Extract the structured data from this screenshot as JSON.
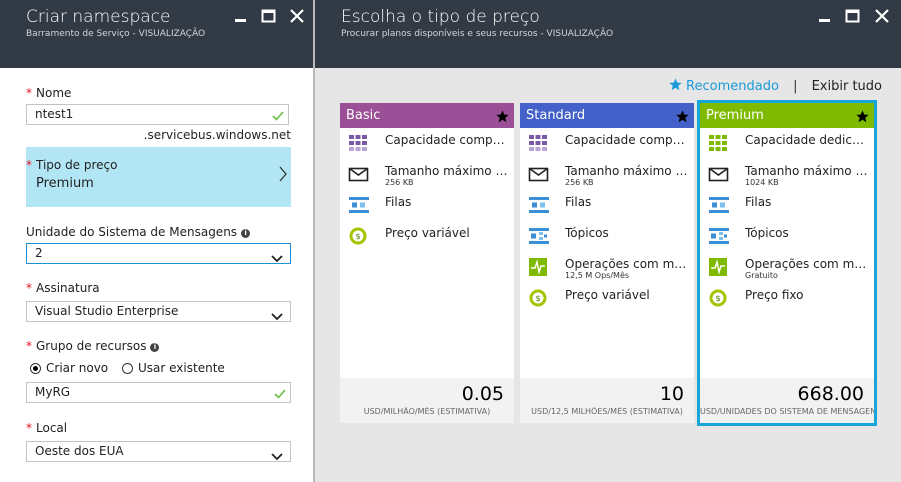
{
  "left": {
    "title": "Criar namespace",
    "subtitle": "Barramento de Serviço - VISUALIZAÇÃO",
    "name_label": "Nome",
    "name_value": "ntest1",
    "name_suffix": ".servicebus.windows.net",
    "pricing_label": "Tipo de preço",
    "pricing_value": "Premium",
    "units_label": "Unidade do Sistema de Mensagens",
    "units_value": "2",
    "subscription_label": "Assinatura",
    "subscription_value": "Visual Studio Enterprise",
    "rg_label": "Grupo de recursos",
    "rg_create_new": "Criar novo",
    "rg_use_existing": "Usar existente",
    "rg_value": "MyRG",
    "location_label": "Local",
    "location_value": "Oeste dos EUA",
    "required_mark": "*",
    "info_mark": "i"
  },
  "right": {
    "title": "Escolha o tipo de preço",
    "subtitle": "Procurar planos disponíveis e seus recursos - VISUALIZAÇÃO",
    "recommended": "Recomendado",
    "separator": "|",
    "view_all": "Exibir tudo",
    "cards": [
      {
        "name": "Basic",
        "color": "#9b4f96",
        "features": [
          {
            "icon": "capacity-icon",
            "title": "Capacidade compartilhada",
            "sub": ""
          },
          {
            "icon": "message-size-icon",
            "title": "Tamanho máximo da mensagem",
            "sub": "256 KB"
          },
          {
            "icon": "queues-icon",
            "title": "Filas",
            "sub": ""
          },
          {
            "icon": "price-icon",
            "title": "Preço variável",
            "sub": ""
          }
        ],
        "price": "0.05",
        "unit": "USD/MILHÃO/MÊS (ESTIMATIVA)"
      },
      {
        "name": "Standard",
        "color": "#4361c8",
        "features": [
          {
            "icon": "capacity-icon",
            "title": "Capacidade compartilhada",
            "sub": ""
          },
          {
            "icon": "message-size-icon",
            "title": "Tamanho máximo da mensagem",
            "sub": "256 KB"
          },
          {
            "icon": "queues-icon",
            "title": "Filas",
            "sub": ""
          },
          {
            "icon": "topics-icon",
            "title": "Tópicos",
            "sub": ""
          },
          {
            "icon": "operations-icon",
            "title": "Operações com mensagens",
            "sub": "12,5 M Ops/Mês"
          },
          {
            "icon": "price-icon",
            "title": "Preço variável",
            "sub": ""
          }
        ],
        "price": "10",
        "unit": "USD/12,5 MILHÕES/MÊS (ESTIMATIVA)"
      },
      {
        "name": "Premium",
        "color": "#7fba00",
        "features": [
          {
            "icon": "dedicated-capacity-icon",
            "title": "Capacidade dedicada",
            "sub": ""
          },
          {
            "icon": "message-size-icon",
            "title": "Tamanho máximo da mensagem",
            "sub": "1024 KB"
          },
          {
            "icon": "queues-icon",
            "title": "Filas",
            "sub": ""
          },
          {
            "icon": "topics-icon",
            "title": "Tópicos",
            "sub": ""
          },
          {
            "icon": "operations-icon",
            "title": "Operações com mensagens",
            "sub": "Gratuito"
          },
          {
            "icon": "price-icon",
            "title": "Preço fixo",
            "sub": ""
          }
        ],
        "price": "668.00",
        "unit": "USD/UNIDADES DO SISTEMA DE MENSAGENS/MÊS (ESTIMATIVA)"
      }
    ]
  },
  "colors": {
    "header_bg": "#323a45",
    "selected_row": "#b2e6f5",
    "accent": "#1a9bd8",
    "check_green": "#6cbd45",
    "basic": "#9b4f96",
    "standard": "#4361c8",
    "premium": "#7fba00"
  }
}
